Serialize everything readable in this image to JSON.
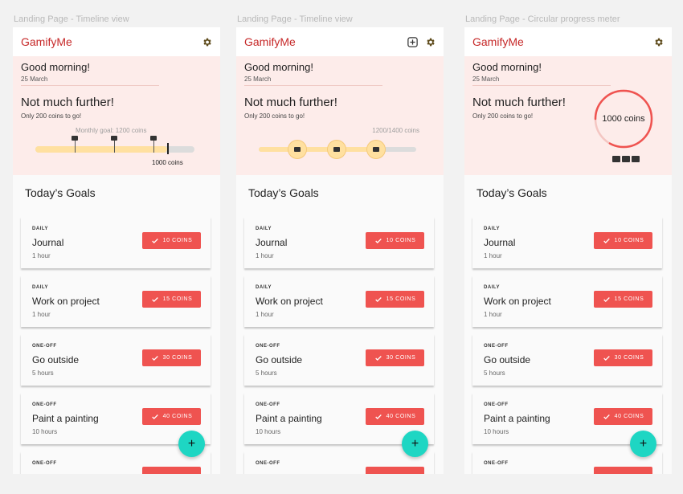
{
  "frames": [
    {
      "label": "Landing Page - Timeline view",
      "app_title": "GamifyMe",
      "greeting": "Good morning!",
      "date": "25 March",
      "headline": "Not much further!",
      "subline": "Only 200 coins to go!",
      "goal_label": "Monthly goal: 1200 coins",
      "target_label": "1000 coins",
      "progress_fraction": 0.83
    },
    {
      "label": "Landing Page - Timeline view",
      "app_title": "GamifyMe",
      "greeting": "Good morning!",
      "date": "25 March",
      "headline": "Not much further!",
      "subline": "Only 200 coins to go!",
      "count_label": "1200/1400 coins",
      "progress_fraction": 0.75
    },
    {
      "label": "Landing Page - Circular progress meter",
      "app_title": "GamifyMe",
      "greeting": "Good morning!",
      "date": "25 March",
      "headline": "Not much further!",
      "subline": "Only 200 coins to go!",
      "ring_label": "1000 coins",
      "progress_fraction": 0.83
    }
  ],
  "goals_heading": "Today’s Goals",
  "goals": [
    {
      "kind": "DAILY",
      "title": "Journal",
      "duration": "1 hour",
      "coins": "10 COINS"
    },
    {
      "kind": "DAILY",
      "title": "Work on project",
      "duration": "1 hour",
      "coins": "15 COINS"
    },
    {
      "kind": "ONE-OFF",
      "title": "Go outside",
      "duration": "5 hours",
      "coins": "30 COINS"
    },
    {
      "kind": "ONE-OFF",
      "title": "Paint a painting",
      "duration": "10 hours",
      "coins": "40 COINS"
    },
    {
      "kind": "ONE-OFF",
      "title": "",
      "duration": "",
      "coins": ""
    }
  ],
  "fab_label": "+",
  "icons": {
    "settings": "gear-icon",
    "add": "add-box-icon",
    "check": "check-icon",
    "chest": "treasure-chest-icon"
  },
  "colors": {
    "accent": "#ef5350",
    "brand": "#c62828",
    "hero_bg": "#fdecea",
    "fab": "#1ed6c3",
    "progress": "#ffe0a0"
  }
}
